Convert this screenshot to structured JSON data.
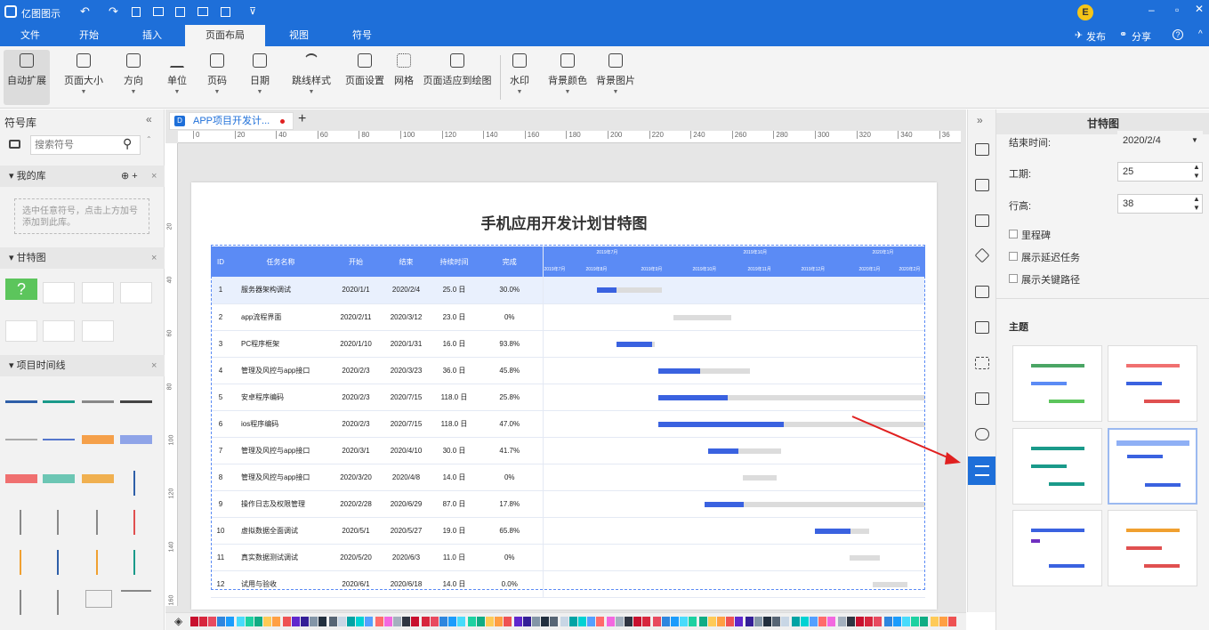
{
  "app": {
    "title": "亿图图示",
    "user_initial": "E",
    "publish": "发布",
    "share": "分享"
  },
  "menu_tabs": [
    "文件",
    "开始",
    "插入",
    "页面布局",
    "视图",
    "符号"
  ],
  "ribbon": [
    "自动扩展",
    "页面大小",
    "方向",
    "单位",
    "页码",
    "日期",
    "跳线样式",
    "页面设置",
    "网格",
    "页面适应到绘图",
    "水印",
    "背景颜色",
    "背景图片"
  ],
  "left": {
    "title": "符号库",
    "search_placeholder": "搜索符号",
    "my_lib": "我的库",
    "my_lib_hint": "选中任意符号，点击上方加号添加到此库。",
    "gantt_section": "甘特图",
    "timeline_section": "项目时间线"
  },
  "doc_tab": "APP项目开发计...",
  "ruler_ticks": [
    "0",
    "20",
    "40",
    "60",
    "80",
    "100",
    "120",
    "140",
    "160",
    "180",
    "200",
    "220",
    "240",
    "260",
    "280",
    "300",
    "320",
    "340",
    "36"
  ],
  "vruler_ticks": [
    "20",
    "40",
    "60",
    "80",
    "100",
    "120",
    "140",
    "160"
  ],
  "chart_data": {
    "type": "table",
    "title": "手机应用开发计划甘特图",
    "columns": [
      "ID",
      "任务名称",
      "开始",
      "结束",
      "持续时间",
      "完成"
    ],
    "timeline_top": [
      "2019年7月",
      "2019年10月",
      "2020年1月"
    ],
    "timeline_months": [
      "2019年7月",
      "2019年8月",
      "2019年9月",
      "2019年10月",
      "2019年11月",
      "2019年12月",
      "2020年1月",
      "2020年2月"
    ],
    "rows": [
      {
        "id": "1",
        "name": "服务器架构调试",
        "start": "2020/1/1",
        "end": "2020/2/4",
        "dur": "25.0 日",
        "done": "30.0%",
        "done_v": 30,
        "s": 0.14,
        "e": 0.31
      },
      {
        "id": "2",
        "name": "app流程界面",
        "start": "2020/2/11",
        "end": "2020/3/12",
        "dur": "23.0 日",
        "done": "0%",
        "done_v": 0,
        "s": 0.34,
        "e": 0.49
      },
      {
        "id": "3",
        "name": "PC程序框架",
        "start": "2020/1/10",
        "end": "2020/1/31",
        "dur": "16.0 日",
        "done": "93.8%",
        "done_v": 93.8,
        "s": 0.19,
        "e": 0.29
      },
      {
        "id": "4",
        "name": "管理及风控与app接口",
        "start": "2020/2/3",
        "end": "2020/3/23",
        "dur": "36.0 日",
        "done": "45.8%",
        "done_v": 45.8,
        "s": 0.3,
        "e": 0.54
      },
      {
        "id": "5",
        "name": "安卓程序编码",
        "start": "2020/2/3",
        "end": "2020/7/15",
        "dur": "118.0 日",
        "done": "25.8%",
        "done_v": 25.8,
        "s": 0.3,
        "e": 1.0
      },
      {
        "id": "6",
        "name": "ios程序编码",
        "start": "2020/2/3",
        "end": "2020/7/15",
        "dur": "118.0 日",
        "done": "47.0%",
        "done_v": 47,
        "s": 0.3,
        "e": 1.0
      },
      {
        "id": "7",
        "name": "管理及风控与app接口",
        "start": "2020/3/1",
        "end": "2020/4/10",
        "dur": "30.0 日",
        "done": "41.7%",
        "done_v": 41.7,
        "s": 0.43,
        "e": 0.62
      },
      {
        "id": "8",
        "name": "管理及风控与app接口",
        "start": "2020/3/20",
        "end": "2020/4/8",
        "dur": "14.0 日",
        "done": "0%",
        "done_v": 0,
        "s": 0.52,
        "e": 0.61
      },
      {
        "id": "9",
        "name": "操作日志及权限管理",
        "start": "2020/2/28",
        "end": "2020/6/29",
        "dur": "87.0 日",
        "done": "17.8%",
        "done_v": 17.8,
        "s": 0.42,
        "e": 1.0
      },
      {
        "id": "10",
        "name": "虚拟数据全面调试",
        "start": "2020/5/1",
        "end": "2020/5/27",
        "dur": "19.0 日",
        "done": "65.8%",
        "done_v": 65.8,
        "s": 0.71,
        "e": 0.85
      },
      {
        "id": "11",
        "name": "真实数据测试调试",
        "start": "2020/5/20",
        "end": "2020/6/3",
        "dur": "11.0 日",
        "done": "0%",
        "done_v": 0,
        "s": 0.8,
        "e": 0.88
      },
      {
        "id": "12",
        "name": "试用与验收",
        "start": "2020/6/1",
        "end": "2020/6/18",
        "dur": "14.0 日",
        "done": "0.0%",
        "done_v": 0,
        "s": 0.86,
        "e": 0.95
      }
    ]
  },
  "right": {
    "title": "甘特图",
    "end_label": "结束时间:",
    "end_value": "2020/2/4",
    "period_label": "工期:",
    "period_value": "25",
    "row_h_label": "行高:",
    "row_h_value": "38",
    "cb1": "里程碑",
    "cb2": "展示延迟任务",
    "cb3": "展示关键路径",
    "theme_label": "主题"
  },
  "colors": {
    "brand": "#1e6fd9",
    "header": "#5b8bf5",
    "bar": "#3a62e0",
    "arrow": "#e02020"
  },
  "palette": [
    "#c8102e",
    "#d7263d",
    "#e84a5f",
    "#2e86de",
    "#1b9cfc",
    "#48dbfb",
    "#1dd1a1",
    "#10ac84",
    "#feca57",
    "#ff9f43",
    "#ee5253",
    "#5f27cd",
    "#341f97",
    "#8395a7",
    "#222f3e",
    "#576574",
    "#c8d6e5",
    "#01a3a4",
    "#00d2d3",
    "#54a0ff",
    "#ff6b6b",
    "#f368e0",
    "#a4b0be",
    "#2f3542"
  ]
}
